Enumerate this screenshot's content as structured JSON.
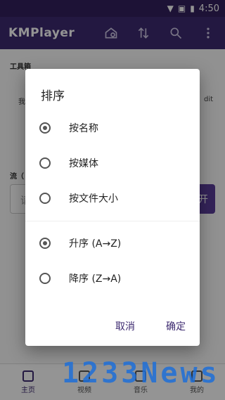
{
  "status_bar": {
    "time": "4:50"
  },
  "app_bar": {
    "title": "KMPlayer",
    "icons": [
      "home-settings-icon",
      "sort-icon",
      "search-icon",
      "more-vert-icon"
    ]
  },
  "background": {
    "toolbox_label": "工具箱",
    "tool_partial_left": "我",
    "tool_partial_right": "dit",
    "stream_label": "流（",
    "stream_input_partial": "请",
    "stream_button_partial": "开"
  },
  "dialog": {
    "title": "排序",
    "sort_by": [
      {
        "label": "按名称",
        "checked": true
      },
      {
        "label": "按媒体",
        "checked": false
      },
      {
        "label": "按文件大小",
        "checked": false
      }
    ],
    "order": [
      {
        "label": "升序 (A→Z)",
        "checked": true
      },
      {
        "label": "降序 (Z→A)",
        "checked": false
      }
    ],
    "cancel_label": "取消",
    "ok_label": "确定"
  },
  "bottom_nav": [
    {
      "label": "主页",
      "active": true
    },
    {
      "label": "视频",
      "active": false
    },
    {
      "label": "音乐",
      "active": false
    },
    {
      "label": "我的",
      "active": false
    }
  ],
  "watermark": "1233News"
}
